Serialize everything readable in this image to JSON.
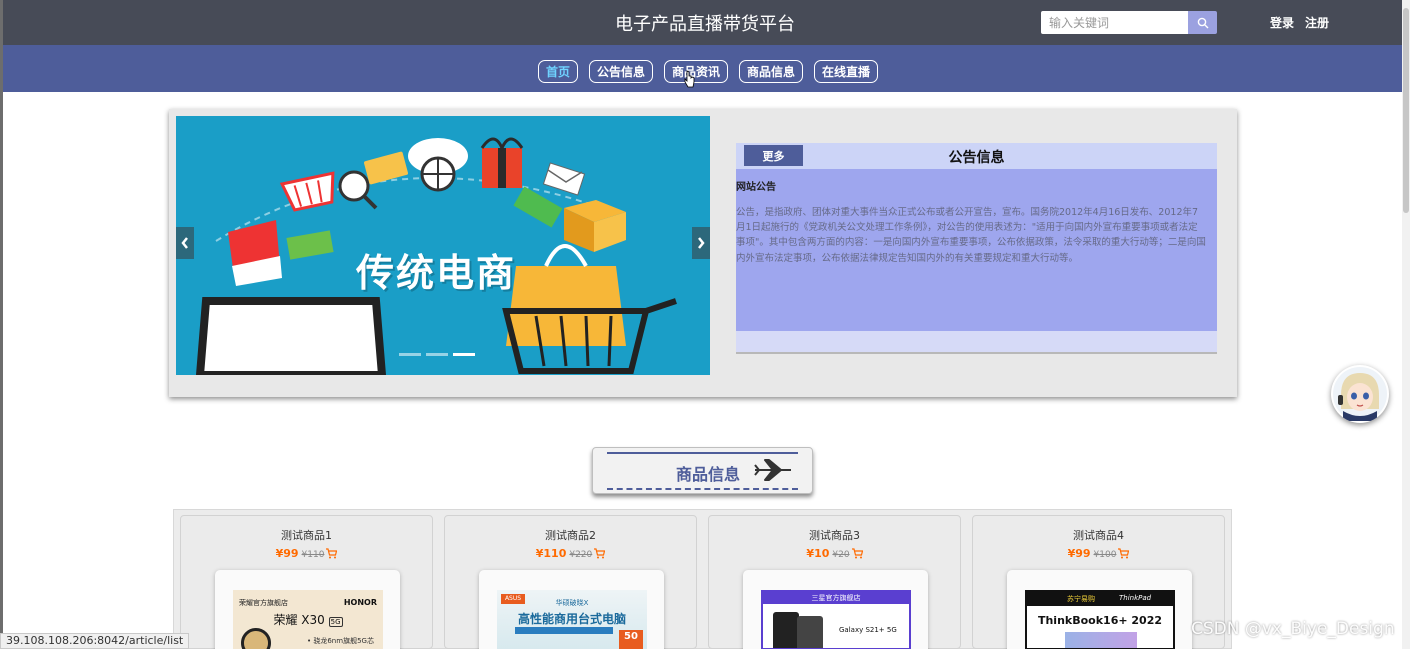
{
  "header": {
    "site_title": "电子产品直播带货平台",
    "search": {
      "placeholder": "输入关键词",
      "value": ""
    },
    "login": "登录",
    "register": "注册"
  },
  "nav": {
    "items": [
      "首页",
      "公告信息",
      "商品资讯",
      "商品信息",
      "在线直播"
    ],
    "active_index": 0
  },
  "banner": {
    "slide_text": "传统电商",
    "dots": 3,
    "active_dot": 2
  },
  "notice": {
    "more": "更多",
    "title": "公告信息",
    "subtitle": "网站公告",
    "body": "公告，是指政府、团体对重大事件当众正式公布或者公开宣告，宣布。国务院2012年4月16日发布、2012年7月1日起施行的《党政机关公文处理工作条例》，对公告的使用表述为：\"适用于向国内外宣布重要事项或者法定事项\"。其中包含两方面的内容：一是向国内外宣布重要事项，公布依据政策，法令采取的重大行动等；二是向国内外宣布法定事项，公布依据法律规定告知国内外的有关重要规定和重大行动等。"
  },
  "products_section": {
    "title": "商品信息"
  },
  "products": [
    {
      "name": "测试商品1",
      "price": "¥99",
      "old_price": "¥110",
      "img_brand": "荣耀官方旗舰店",
      "img_logo": "HONOR",
      "img_title": "荣耀 X30",
      "img_badge": "5G",
      "img_note": "• 骁龙6nm旗舰5G芯"
    },
    {
      "name": "测试商品2",
      "price": "¥110",
      "old_price": "¥220",
      "img_brand": "华硕破晓X",
      "img_logo": "ASUS",
      "img_title": "高性能商用台式电脑",
      "img_badge": "50"
    },
    {
      "name": "测试商品3",
      "price": "¥10",
      "old_price": "¥20",
      "img_brand": "三星官方旗舰店",
      "img_title": "Galaxy S21+ 5G"
    },
    {
      "name": "测试商品4",
      "price": "¥99",
      "old_price": "¥100",
      "img_brand": "苏宁易购",
      "img_logo": "ThinkPad",
      "img_title": "ThinkBook16+ 2022"
    }
  ],
  "statusbar": {
    "url": "39.108.108.206:8042/article/list"
  },
  "watermark": "CSDN @vx_Biye_Design",
  "colors": {
    "header": "#474b57",
    "nav": "#4e5d9a",
    "accent": "#9ea6ee",
    "price": "#ff6a00"
  }
}
